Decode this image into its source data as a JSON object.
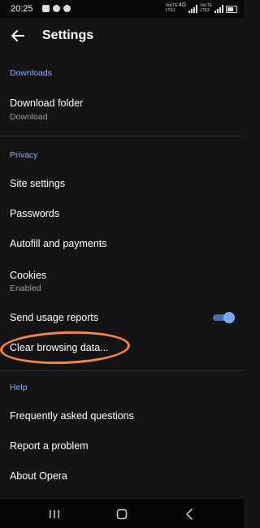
{
  "status_bar": {
    "time": "20:25",
    "sim1_label_top": "VoLTE",
    "sim1_label_net": "4G",
    "sim1_label_bottom": "LTE1",
    "sim2_label_top": "VoLTE",
    "sim2_label_bottom": "LTE2"
  },
  "appbar": {
    "title": "Settings",
    "back_icon": "arrow-back-icon"
  },
  "sections": {
    "downloads": {
      "header": "Downloads",
      "download_folder": {
        "label": "Download folder",
        "value": "Download"
      }
    },
    "privacy": {
      "header": "Privacy",
      "site_settings": "Site settings",
      "passwords": "Passwords",
      "autofill": "Autofill and payments",
      "cookies": {
        "label": "Cookies",
        "value": "Enabled"
      },
      "usage_reports": {
        "label": "Send usage reports",
        "enabled": true
      },
      "clear_data": "Clear browsing data..."
    },
    "help": {
      "header": "Help",
      "faq": "Frequently asked questions",
      "report": "Report a problem",
      "about": "About Opera"
    }
  },
  "colors": {
    "background": "#141414",
    "accent": "#8ab4f8",
    "toggle_on": "#7aa7f0",
    "annotation": "#f5883a"
  },
  "navbar": {
    "icons": [
      "recent-apps-icon",
      "home-icon",
      "back-icon"
    ]
  }
}
